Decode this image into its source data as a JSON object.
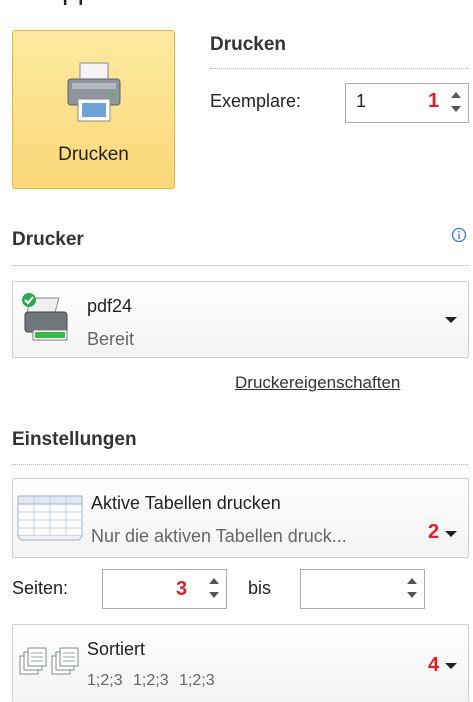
{
  "top_cut_text": "pp",
  "print_button": {
    "label": "Drucken"
  },
  "print_section": {
    "title": "Drucken",
    "copies_label": "Exemplare:",
    "copies_value": "1",
    "copies_marker": "1"
  },
  "printer_section": {
    "title": "Drucker",
    "printer_name": "pdf24",
    "printer_status": "Bereit",
    "properties_link": "Druckereigenschaften"
  },
  "settings_section": {
    "title": "Einstellungen",
    "scope": {
      "title": "Aktive Tabellen drucken",
      "subtitle": "Nur die aktiven Tabellen druck...",
      "marker": "2"
    },
    "pages": {
      "label": "Seiten:",
      "from_value": "",
      "from_marker": "3",
      "to_label": "bis",
      "to_value": ""
    },
    "collation": {
      "title": "Sortiert",
      "subtitle": "1;2;3    1;2;3    1;2;3",
      "marker": "4"
    }
  },
  "icons": [
    "printer-icon",
    "info-icon",
    "printer-ready-icon",
    "sheets-icon",
    "collated-icon",
    "chevron-down-icon",
    "spinner-up-icon",
    "spinner-down-icon"
  ],
  "colors": {
    "button_bg": "#fbd877",
    "marker_red": "#e31e24"
  }
}
